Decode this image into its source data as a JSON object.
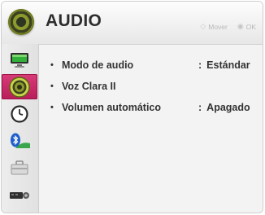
{
  "header": {
    "title": "AUDIO",
    "icon": "speaker-icon",
    "hints": {
      "move_glyph": "◇",
      "move_label": "Mover",
      "ok_glyph": "◉",
      "ok_label": "OK"
    }
  },
  "sidebar": {
    "items": [
      {
        "name": "picture",
        "icon": "monitor-icon"
      },
      {
        "name": "audio",
        "icon": "speaker-icon",
        "active": true
      },
      {
        "name": "time",
        "icon": "clock-icon"
      },
      {
        "name": "bluetooth",
        "icon": "bluetooth-icon"
      },
      {
        "name": "options",
        "icon": "toolbox-icon"
      },
      {
        "name": "input",
        "icon": "input-device-icon"
      }
    ]
  },
  "menu": {
    "bullet": "•",
    "colon": ":",
    "items": [
      {
        "label": "Modo de audio",
        "value": "Estándar"
      },
      {
        "label": "Voz Clara II",
        "value": ""
      },
      {
        "label": "Volumen automático",
        "value": "Apagado"
      }
    ]
  },
  "colors": {
    "accent": "#c52a66",
    "speaker_green": "#9caa2e"
  }
}
